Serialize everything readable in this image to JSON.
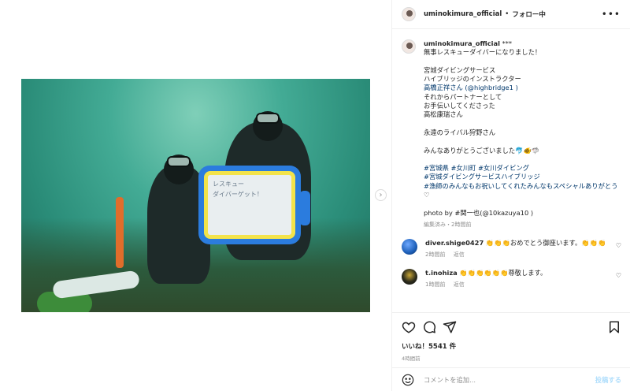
{
  "header": {
    "username": "uminokimura_official",
    "separator": "•",
    "follow_label": "フォロー中",
    "more_icon": "more-horizontal-icon"
  },
  "caption": {
    "username": "uminokimura_official",
    "suffix": "***",
    "lines": [
      "無事レスキューダイバーになりました！",
      "",
      "宮城ダイビングサービス",
      "ハイブリッジのインストラクター",
      "高橋正祥さん (@highbridge1 )",
      "それからパートナーとして",
      "お手伝いしてくださった",
      "高松康瑞さん",
      "",
      "永遠のライバル狩野さん",
      "",
      "みんなありがとうございました🐬🐠🦈",
      "",
      "#宮城県 #女川町 #女川ダイビング",
      "#宮城ダイビングサービスハイブリッジ",
      "#漁師のみんなもお祝いしてくれたみんなもスペシャルありがとう",
      "♡",
      "",
      "photo by #関一也(@10kazuya10 )"
    ],
    "meta": "編集済み・2時間前"
  },
  "comments": [
    {
      "username": "diver.shige0427",
      "text": "👏👏👏おめでとう御座います。👏👏👏",
      "time": "2時間前",
      "reply": "返信",
      "avatar_color": "#1d5fb8"
    },
    {
      "username": "t.inohiza",
      "text": "👏👏👏👏👏👏尊敬します。",
      "time": "1時間前",
      "reply": "返信",
      "avatar_color": "#2b2b1c"
    }
  ],
  "actions": {
    "like_icon": "heart-icon",
    "comment_icon": "comment-icon",
    "share_icon": "share-icon",
    "save_icon": "bookmark-icon",
    "likes_label": "いいね！5541 件",
    "time_label": "4時間前"
  },
  "add_comment": {
    "emoji_icon": "emoji-icon",
    "placeholder": "コメントを追加...",
    "post_label": "投稿する"
  },
  "photo": {
    "board_lines": [
      "レスキュー",
      "ダイバーゲット！"
    ]
  },
  "nav": {
    "next_arrow": "›"
  },
  "colors": {
    "link": "#00376b",
    "muted": "#8e8e8e",
    "post_disabled": "#b2dffc"
  }
}
